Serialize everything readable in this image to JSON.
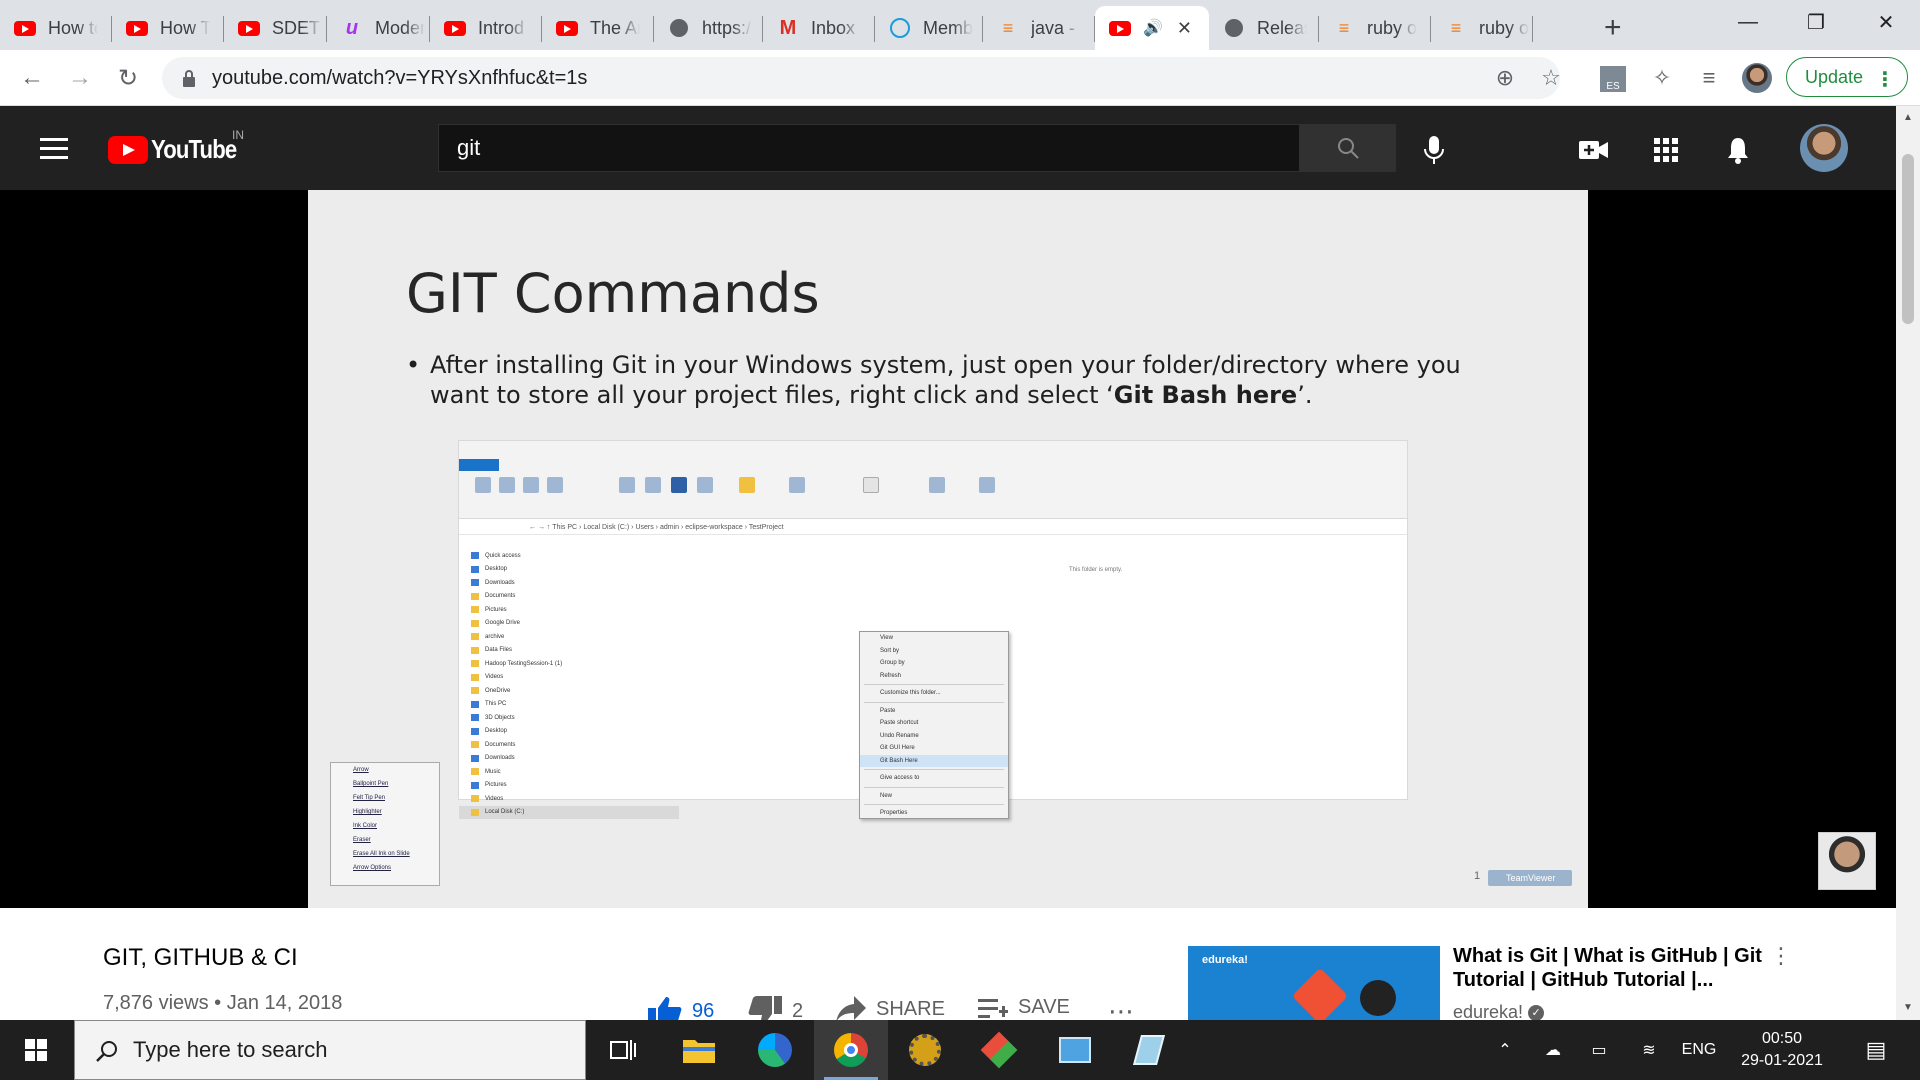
{
  "browser": {
    "tabs": [
      {
        "title": "How to",
        "favicon": "youtube-icon"
      },
      {
        "title": "How T",
        "favicon": "youtube-icon"
      },
      {
        "title": "SDET -",
        "favicon": "youtube-icon"
      },
      {
        "title": "Moder",
        "favicon": "udemy-icon"
      },
      {
        "title": "Introd",
        "favicon": "youtube-icon"
      },
      {
        "title": "The Ar",
        "favicon": "youtube-icon"
      },
      {
        "title": "https:/",
        "favicon": "globe-icon"
      },
      {
        "title": "Inbox (",
        "favicon": "gmail-icon"
      },
      {
        "title": "Memb",
        "favicon": "teachable-icon"
      },
      {
        "title": "java - (",
        "favicon": "stackoverflow-icon"
      },
      {
        "title": "",
        "favicon": "youtube-icon",
        "active": true
      },
      {
        "title": "Releas",
        "favicon": "globe-icon"
      },
      {
        "title": "ruby o",
        "favicon": "stackoverflow-icon"
      },
      {
        "title": "ruby o",
        "favicon": "stackoverflow-icon"
      }
    ],
    "url": "youtube.com/watch?v=YRYsXnfhfuc&t=1s",
    "update_label": "Update",
    "ext_badge": "ES"
  },
  "youtube": {
    "logo_text": "YouTube",
    "region": "IN",
    "search_value": "git"
  },
  "slide": {
    "title": "GIT Commands",
    "bullet_pre": "After installing Git in your Windows system, just open your folder/directory where you want to store all your project files, right click and select ‘",
    "bullet_bold": "Git Bash here",
    "bullet_post": "’.",
    "explorer": {
      "path": "←  →  ↑   This PC  ›  Local Disk (C:)  ›  Users  ›  admin  ›  eclipse-workspace  ›  TestProject",
      "empty_msg": "This folder is empty.",
      "nav_items": [
        "Quick access",
        "Desktop",
        "Downloads",
        "Documents",
        "Pictures",
        "Google Drive",
        "archive",
        "Data Files",
        "Hadoop TestingSession-1 (1)",
        "Videos",
        "OneDrive",
        "This PC",
        "3D Objects",
        "Desktop",
        "Documents",
        "Downloads",
        "Music",
        "Pictures",
        "Videos",
        "Local Disk (C:)"
      ],
      "context_menu": [
        "View",
        "Sort by",
        "Group by",
        "Refresh",
        "-",
        "Customize this folder...",
        "-",
        "Paste",
        "Paste shortcut",
        "Undo Rename",
        "Git GUI Here",
        "Git Bash Here",
        "-",
        "Give access to",
        "-",
        "New",
        "-",
        "Properties"
      ],
      "ink_menu": [
        "Arrow",
        "Ballpoint Pen",
        "Felt Tip Pen",
        "Highlighter",
        "Ink Color",
        "Eraser",
        "Erase All Ink on Slide",
        "Arrow Options"
      ]
    },
    "watermark": "TeamViewer",
    "page_num": "1"
  },
  "video": {
    "title": "GIT, GITHUB & CI",
    "meta": "7,876 views • Jan 14, 2018",
    "likes": "96",
    "dislikes": "2",
    "share_label": "SHARE",
    "save_label": "SAVE"
  },
  "recommended": {
    "title": "What is Git | What is GitHub | Git Tutorial | GitHub Tutorial |...",
    "channel": "edureka!",
    "thumb_brand": "edureka!"
  },
  "taskbar": {
    "search_placeholder": "Type here to search",
    "lang": "ENG",
    "time": "00:50",
    "date": "29-01-2021"
  }
}
